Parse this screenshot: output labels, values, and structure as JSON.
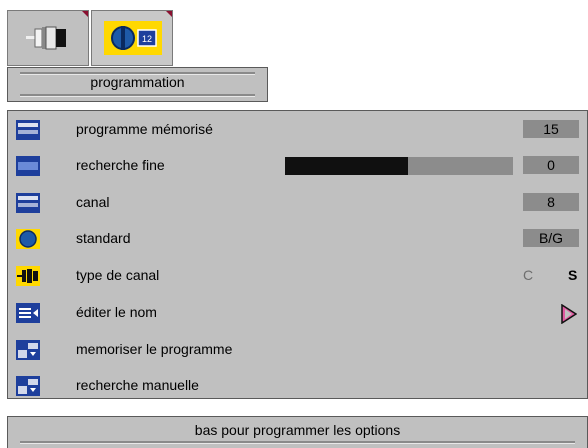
{
  "tabs": [
    {
      "icon": "connector-icon"
    },
    {
      "icon": "tv-channel-icon",
      "active": true
    }
  ],
  "header": {
    "title": "programmation"
  },
  "menu": [
    {
      "icon": "channel-grid-icon",
      "label": "programme mémorisé",
      "value": "15"
    },
    {
      "icon": "fine-tune-icon",
      "label": "recherche fine",
      "value": "0",
      "level_percent": 54
    },
    {
      "icon": "channel-grid-icon",
      "label": "canal",
      "value": "8"
    },
    {
      "icon": "globe-icon",
      "label": "standard",
      "value": "B/G"
    },
    {
      "icon": "connector-icon",
      "label": "type de canal",
      "options": [
        "C",
        "S"
      ],
      "selected": "S"
    },
    {
      "icon": "edit-name-icon",
      "label": "éditer le nom"
    },
    {
      "icon": "store-program-icon",
      "label": "memoriser le programme"
    },
    {
      "icon": "store-program-icon",
      "label": "recherche manuelle"
    }
  ],
  "footer": {
    "hint": "bas pour programmer les options"
  },
  "colors": {
    "panel": "#c0c0c0",
    "icon_bg": "#ffd800",
    "value_box": "#8c8c8c",
    "bar_fill": "#101010",
    "corner": "#8a1030",
    "arrow": "#e05aa0"
  }
}
